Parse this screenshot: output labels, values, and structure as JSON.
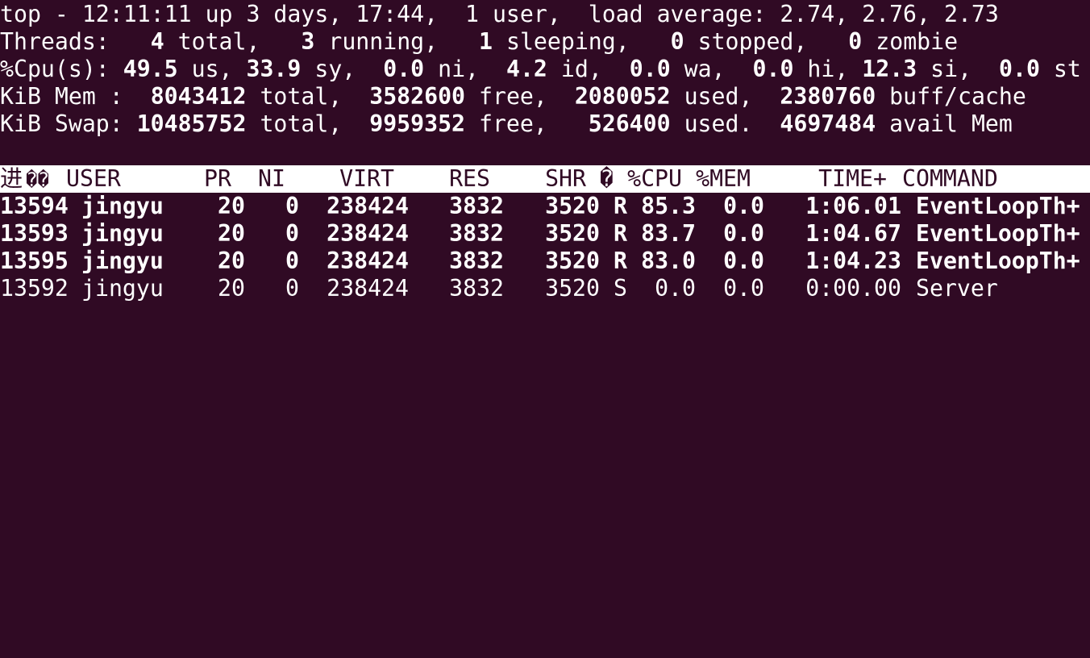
{
  "top": {
    "prefix": "top - ",
    "time": "12:11:11",
    "uptime": " up 3 days, 17:44,  1 user,  load average: ",
    "load": "2.74, 2.76, 2.73"
  },
  "threads": {
    "label": "Threads: ",
    "total": "4",
    "total_lbl": " total, ",
    "running": "3",
    "running_lbl": " running, ",
    "sleeping": "1",
    "sleeping_lbl": " sleeping, ",
    "stopped": "0",
    "stopped_lbl": " stopped, ",
    "zombie": "0",
    "zombie_lbl": " zombie"
  },
  "cpu": {
    "label": "%Cpu(s): ",
    "us": "49.5",
    "us_lbl": " us, ",
    "sy": "33.9",
    "sy_lbl": " sy, ",
    "ni": "0.0",
    "ni_lbl": " ni, ",
    "id": "4.2",
    "id_lbl": " id, ",
    "wa": "0.0",
    "wa_lbl": " wa, ",
    "hi": "0.0",
    "hi_lbl": " hi, ",
    "si": "12.3",
    "si_lbl": " si, ",
    "st": "0.0",
    "st_lbl": " st"
  },
  "mem": {
    "label": "KiB Mem : ",
    "total": "8043412",
    "total_lbl": " total, ",
    "free": "3582600",
    "free_lbl": " free, ",
    "used": "2080052",
    "used_lbl": " used, ",
    "buff": "2380760",
    "buff_lbl": " buff/cache"
  },
  "swap": {
    "label": "KiB Swap: ",
    "total": "10485752",
    "total_lbl": " total, ",
    "free": "9959352",
    "free_lbl": " free, ",
    "used": "526400",
    "used_lbl": " used. ",
    "avail": "4697484",
    "avail_lbl": " avail Mem"
  },
  "header": {
    "pid": "进",
    "pid_glyph": "��",
    "user": "USER",
    "pr": "PR",
    "ni": "NI",
    "virt": "VIRT",
    "res": "RES",
    "shr": "SHR",
    "s": "�",
    "cpu": "%CPU",
    "mem": "%MEM",
    "time": "TIME+",
    "command": "COMMAND"
  },
  "rows": [
    {
      "pid": "13594",
      "user": "jingyu",
      "pr": "20",
      "ni": "0",
      "virt": "238424",
      "res": "3832",
      "shr": "3520",
      "s": "R",
      "cpu": "85.3",
      "mem": "0.0",
      "time": "1:06.01",
      "command": "EventLoopTh+"
    },
    {
      "pid": "13593",
      "user": "jingyu",
      "pr": "20",
      "ni": "0",
      "virt": "238424",
      "res": "3832",
      "shr": "3520",
      "s": "R",
      "cpu": "83.7",
      "mem": "0.0",
      "time": "1:04.67",
      "command": "EventLoopTh+"
    },
    {
      "pid": "13595",
      "user": "jingyu",
      "pr": "20",
      "ni": "0",
      "virt": "238424",
      "res": "3832",
      "shr": "3520",
      "s": "R",
      "cpu": "83.0",
      "mem": "0.0",
      "time": "1:04.23",
      "command": "EventLoopTh+"
    },
    {
      "pid": "13592",
      "user": "jingyu",
      "pr": "20",
      "ni": "0",
      "virt": "238424",
      "res": "3832",
      "shr": "3520",
      "s": "S",
      "cpu": "0.0",
      "mem": "0.0",
      "time": "0:00.00",
      "command": "Server"
    }
  ]
}
